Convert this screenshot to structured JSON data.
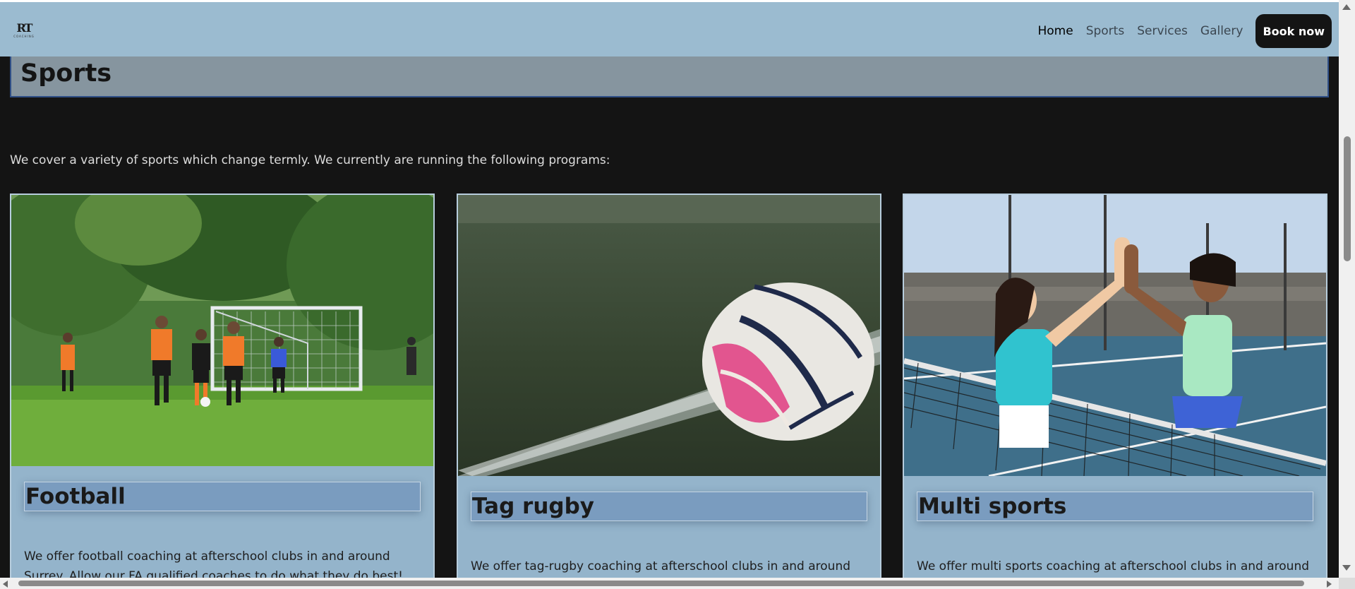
{
  "header": {
    "logo_mark": "RT",
    "logo_sub": "COACHING",
    "nav": [
      "Home",
      "Sports",
      "Services",
      "Gallery"
    ],
    "active_nav": "Home",
    "book_label": "Book now"
  },
  "page": {
    "title": "Sports",
    "intro": "We cover a variety of sports which change termly. We currently are running the following programs:"
  },
  "cards": [
    {
      "title": "Football",
      "description": "We offer football coaching at afterschool clubs in and around Surrey. Allow our FA qualified coaches to do what they do best!",
      "photo": "football-match-photo"
    },
    {
      "title": "Tag rugby",
      "description": "We offer tag-rugby coaching at afterschool clubs in and around Surrey.",
      "photo": "rugby-ball-photo"
    },
    {
      "title": "Multi sports",
      "description": "We offer multi sports coaching at afterschool clubs in and around",
      "photo": "tennis-high-five-photo"
    }
  ],
  "colors": {
    "header_bg": "#9bbbd0",
    "page_bg": "#141414",
    "card_bg": "#94b4cb",
    "title_box_bg": "#7a9cbf",
    "banner_bg": "#86959f",
    "button_bg": "#141414"
  }
}
